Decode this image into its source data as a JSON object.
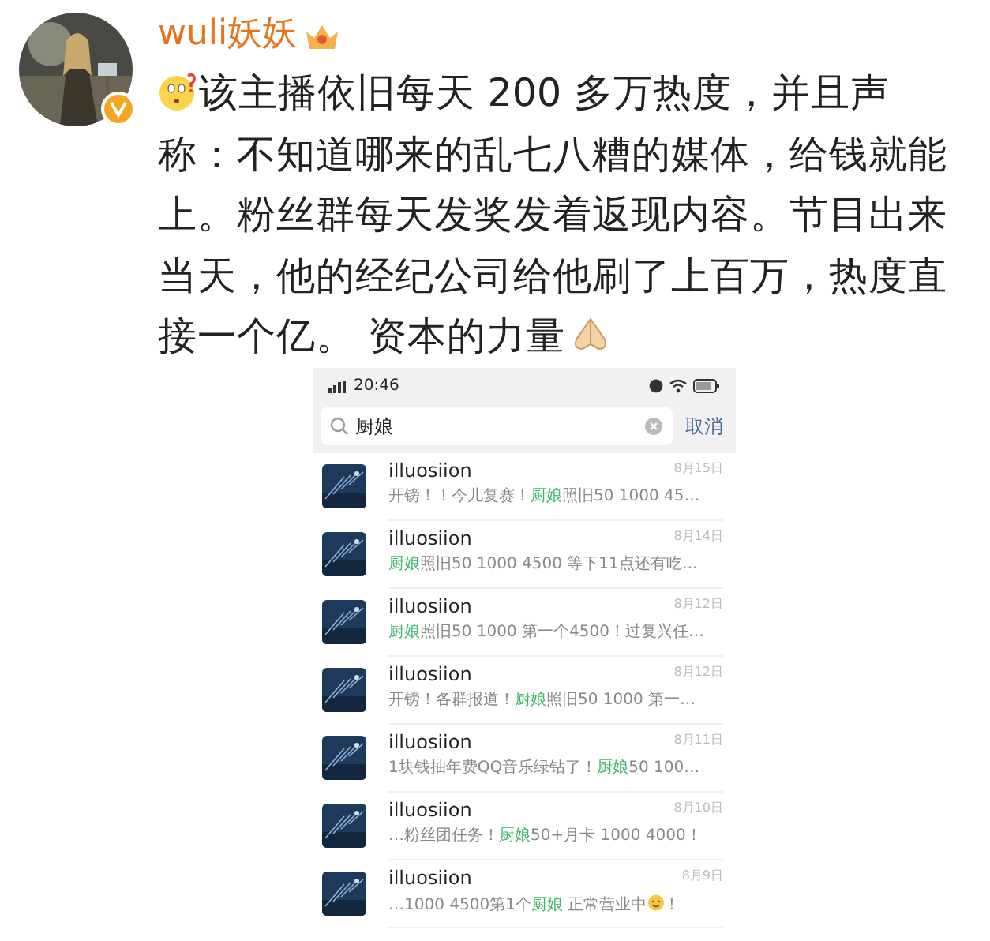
{
  "post": {
    "author": "wuli妖妖",
    "text": "该主播依旧每天 200 多万热度，并且声称：不知道哪来的乱七八糟的媒体，给钱就能上。粉丝群每天发奖发着返现内容。节目出来当天，他的经纪公司给他刷了上百万，热度直接一个亿。 资本的力量"
  },
  "phone": {
    "time": "20:46",
    "search": {
      "value": "厨娘",
      "cancel": "取消"
    },
    "results": [
      {
        "name": "illuosiion",
        "date": "8月15日",
        "before": "开镑！！今儿复赛！",
        "keyword": "厨娘",
        "after": "照旧50 1000 45…"
      },
      {
        "name": "illuosiion",
        "date": "8月14日",
        "keyword": "厨娘",
        "after": "照旧50 1000 4500 等下11点还有吃…"
      },
      {
        "name": "illuosiion",
        "date": "8月12日",
        "keyword": "厨娘",
        "after": "照旧50 1000 第一个4500！过复兴任…"
      },
      {
        "name": "illuosiion",
        "date": "8月12日",
        "before": "开镑！各群报道！",
        "keyword": "厨娘",
        "after": "照旧50 1000 第一…"
      },
      {
        "name": "illuosiion",
        "date": "8月11日",
        "before": "1块钱抽年费QQ音乐绿钻了！",
        "keyword": "厨娘",
        "after": "50 100…"
      },
      {
        "name": "illuosiion",
        "date": "8月10日",
        "before": "…粉丝团任务！",
        "keyword": "厨娘",
        "after": "50+月卡 1000 4000！"
      },
      {
        "name": "illuosiion",
        "date": "8月9日",
        "before": "…1000 4500第1个",
        "keyword": "厨娘",
        "after": " 正常营业中",
        "emoji": true,
        "tail": "！"
      }
    ]
  }
}
